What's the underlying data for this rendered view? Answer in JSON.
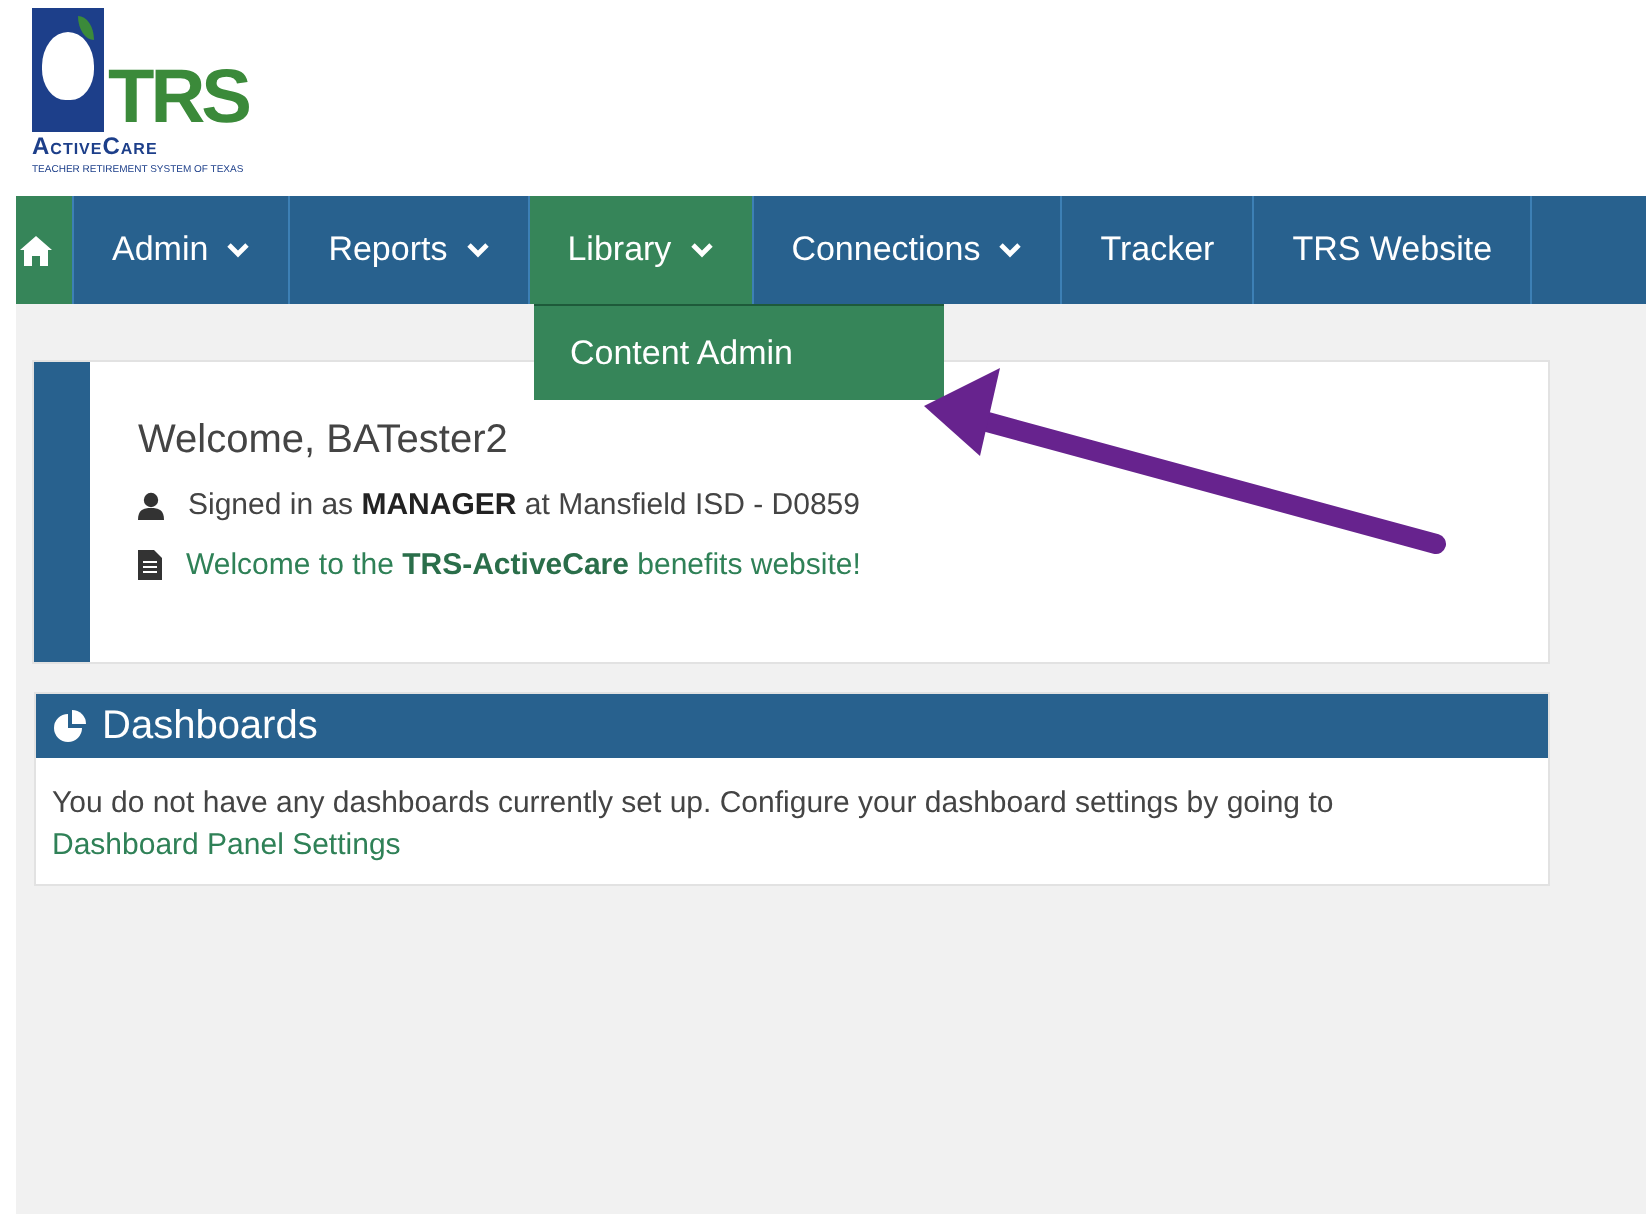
{
  "logo": {
    "title": "TRS",
    "subtitle": "ActiveCare",
    "tagline": "TEACHER RETIREMENT SYSTEM OF TEXAS"
  },
  "nav": [
    {
      "kind": "home",
      "selected": true
    },
    {
      "kind": "link",
      "label": "Admin",
      "has_menu": true,
      "selected": false
    },
    {
      "kind": "link",
      "label": "Reports",
      "has_menu": true,
      "selected": false
    },
    {
      "kind": "link",
      "label": "Library",
      "has_menu": true,
      "selected": true,
      "open_menu": [
        "Content Admin"
      ]
    },
    {
      "kind": "link",
      "label": "Connections",
      "has_menu": true,
      "selected": false
    },
    {
      "kind": "link",
      "label": "Tracker",
      "has_menu": false,
      "selected": false
    },
    {
      "kind": "link",
      "label": "TRS Website",
      "has_menu": false,
      "selected": false
    }
  ],
  "welcome": {
    "title": "Welcome, BATester2",
    "lines": [
      {
        "kind": "user",
        "text": "Signed in as **MANAGER** at Mansfield ISD - D0859"
      },
      {
        "kind": "document",
        "text": "Welcome to the **TRS-ActiveCare** benefits website!"
      }
    ]
  },
  "dashboards": {
    "title": "Dashboards",
    "message": "You do not have any dashboards currently set up. Configure your dashboard settings by going to",
    "link": "Dashboard Panel Settings"
  },
  "annotation": {
    "kind": "arrow",
    "color": "#67238e"
  }
}
